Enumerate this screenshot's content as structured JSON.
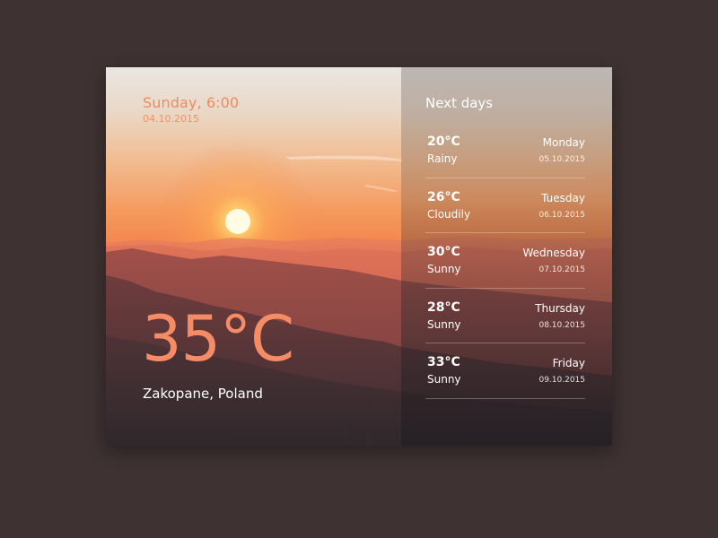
{
  "current": {
    "day_time": "Sunday, 6:00",
    "date": "04.10.2015",
    "temperature": "35°C",
    "location": "Zakopane, Poland"
  },
  "forecast": {
    "title": "Next days",
    "days": [
      {
        "temp": "20°C",
        "condition": "Rainy",
        "day": "Monday",
        "date": "05.10.2015"
      },
      {
        "temp": "26°C",
        "condition": "Cloudily",
        "day": "Tuesday",
        "date": "06.10.2015"
      },
      {
        "temp": "30°C",
        "condition": "Sunny",
        "day": "Wednesday",
        "date": "07.10.2015"
      },
      {
        "temp": "28°C",
        "condition": "Sunny",
        "day": "Thursday",
        "date": "08.10.2015"
      },
      {
        "temp": "33°C",
        "condition": "Sunny",
        "day": "Friday",
        "date": "09.10.2015"
      }
    ]
  },
  "colors": {
    "page_background": "#3e3232",
    "accent": "#f58c66",
    "text": "#ffffff"
  }
}
